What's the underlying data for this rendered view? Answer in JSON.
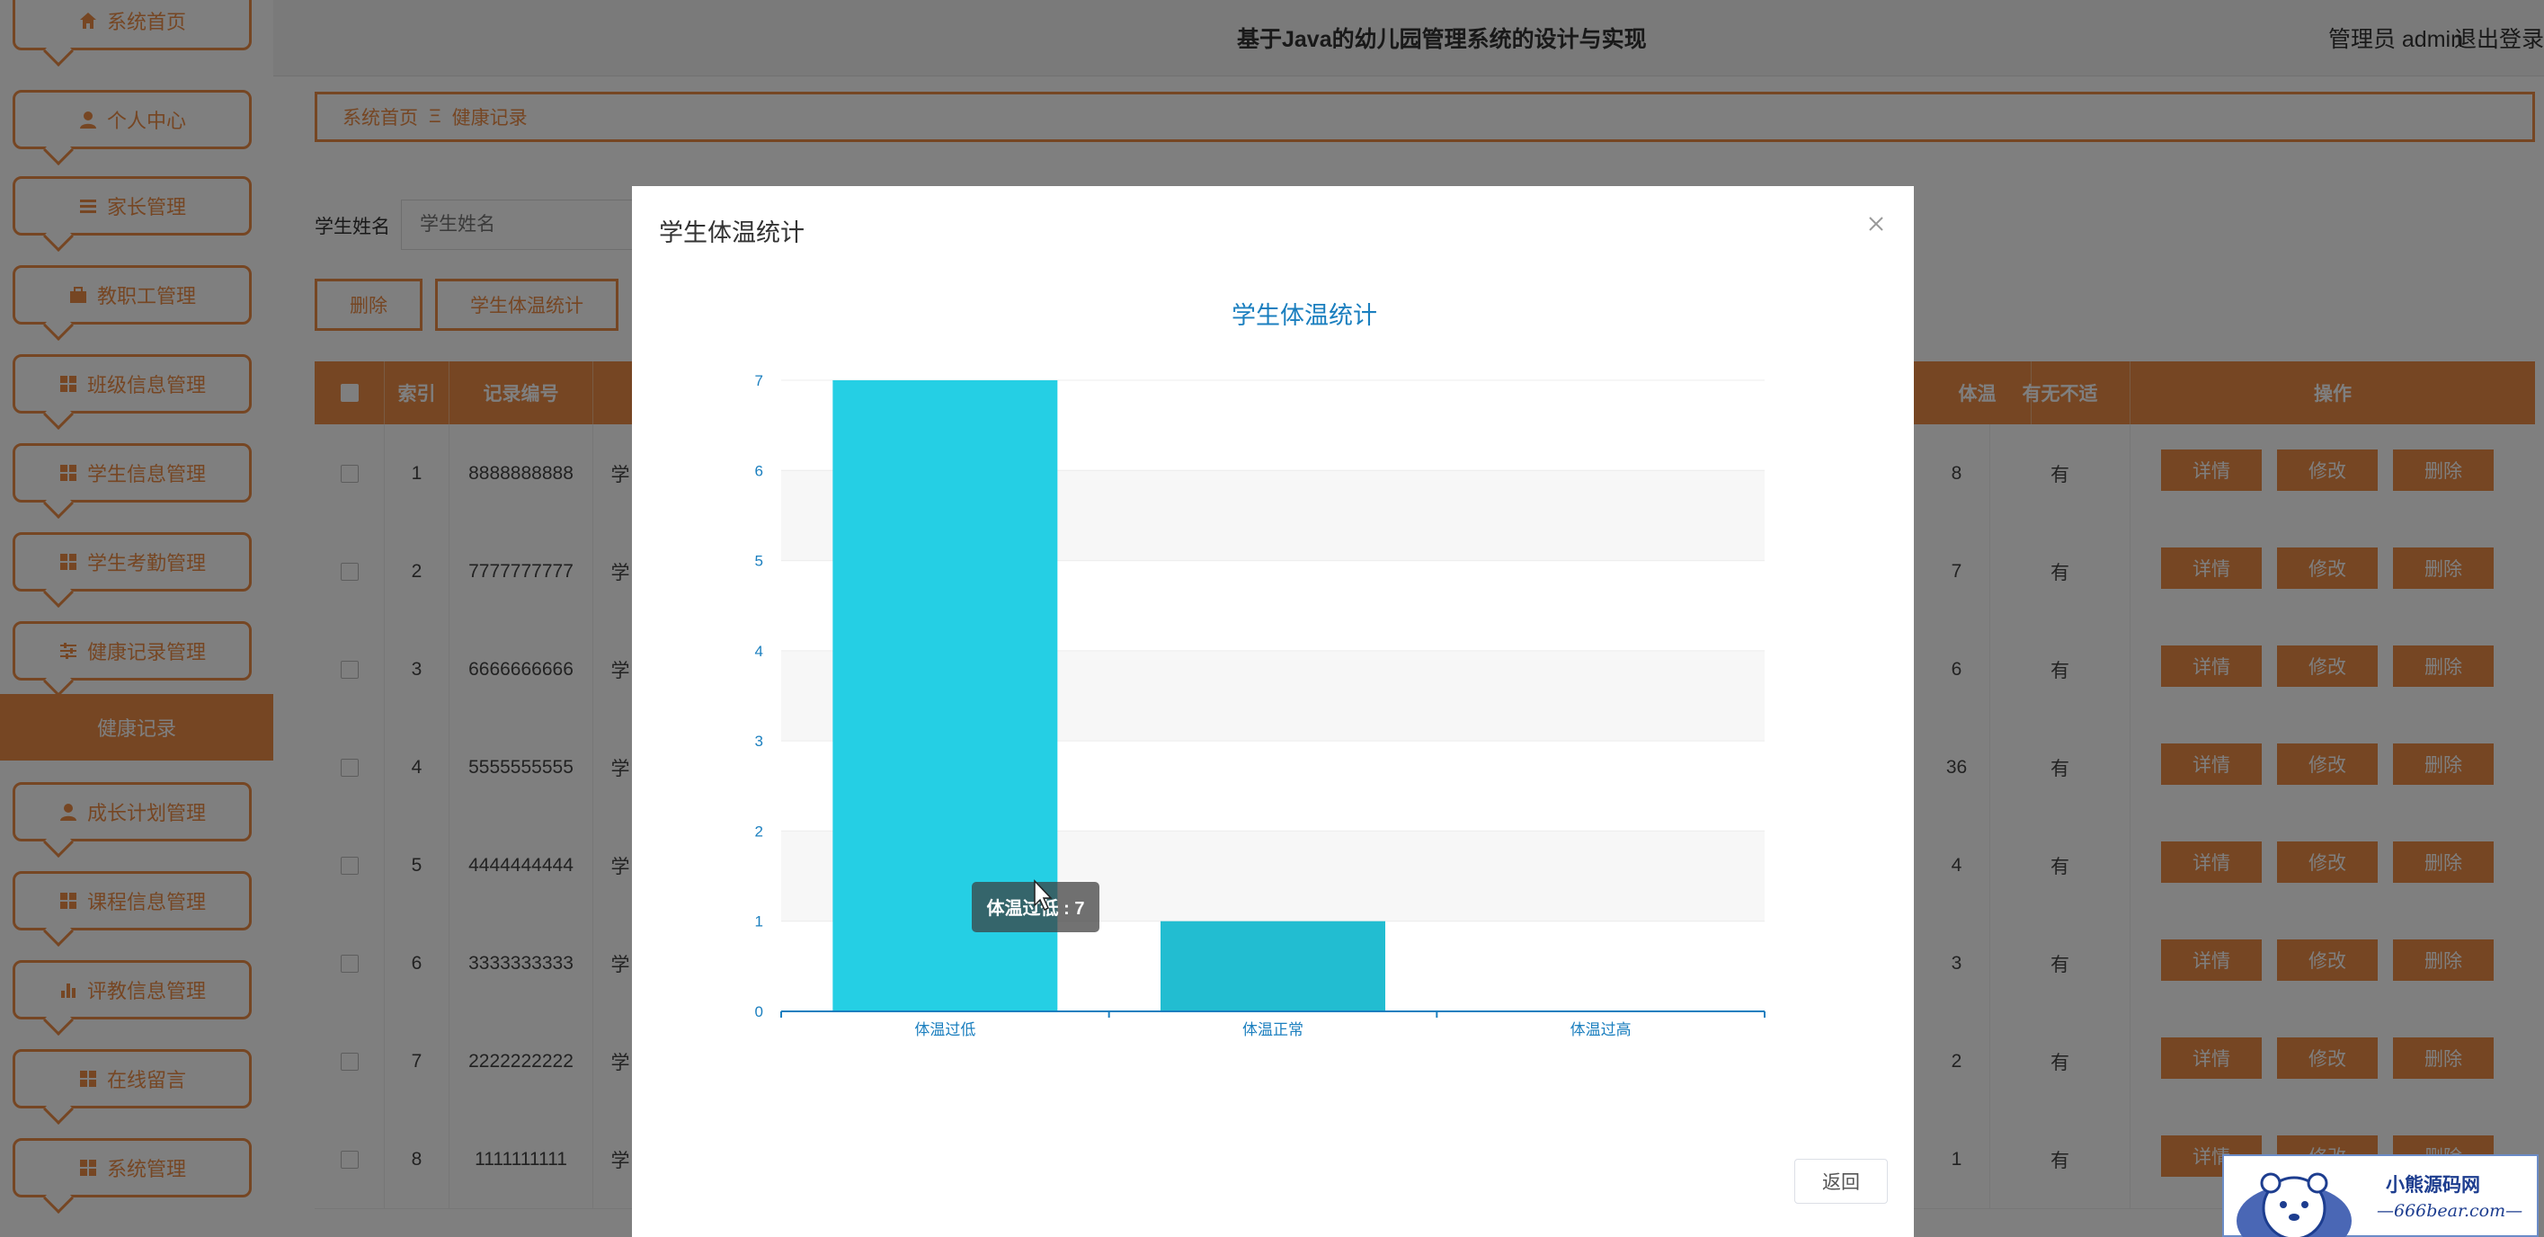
{
  "header": {
    "title": "基于Java的幼儿园管理系统的设计与实现",
    "user": "管理员 admin",
    "logout": "退出登录"
  },
  "sidebar": {
    "items": [
      {
        "label": "系统首页",
        "icon": "home-icon"
      },
      {
        "label": "个人中心",
        "icon": "person-icon"
      },
      {
        "label": "家长管理",
        "icon": "list-icon"
      },
      {
        "label": "教职工管理",
        "icon": "briefcase-icon"
      },
      {
        "label": "班级信息管理",
        "icon": "grid-icon"
      },
      {
        "label": "学生信息管理",
        "icon": "grid-icon"
      },
      {
        "label": "学生考勤管理",
        "icon": "grid-icon"
      },
      {
        "label": "健康记录管理",
        "icon": "sliders-icon"
      },
      {
        "label": "成长计划管理",
        "icon": "person-icon"
      },
      {
        "label": "课程信息管理",
        "icon": "grid-icon"
      },
      {
        "label": "评教信息管理",
        "icon": "bar-chart-icon"
      },
      {
        "label": "在线留言",
        "icon": "grid-icon"
      },
      {
        "label": "系统管理",
        "icon": "grid-icon"
      }
    ],
    "active_sub": "健康记录"
  },
  "breadcrumb": {
    "home": "系统首页",
    "separator": "Ξ",
    "current": "健康记录"
  },
  "search": {
    "label": "学生姓名",
    "placeholder": "学生姓名"
  },
  "toolbar": {
    "delete_label": "删除",
    "stats_label": "学生体温统计"
  },
  "table": {
    "headers": [
      "索引",
      "记录编号",
      "体温",
      "有无不适",
      "操作"
    ],
    "rows": [
      {
        "index": "1",
        "code": "8888888888",
        "s": "学",
        "temp": "8",
        "discomfort": "有"
      },
      {
        "index": "2",
        "code": "7777777777",
        "s": "学",
        "temp": "7",
        "discomfort": "有"
      },
      {
        "index": "3",
        "code": "6666666666",
        "s": "学",
        "temp": "6",
        "discomfort": "有"
      },
      {
        "index": "4",
        "code": "5555555555",
        "s": "学",
        "temp": "36",
        "discomfort": "有"
      },
      {
        "index": "5",
        "code": "4444444444",
        "s": "学",
        "temp": "4",
        "discomfort": "有"
      },
      {
        "index": "6",
        "code": "3333333333",
        "s": "学",
        "temp": "3",
        "discomfort": "有"
      },
      {
        "index": "7",
        "code": "2222222222",
        "s": "学",
        "temp": "2",
        "discomfort": "有"
      },
      {
        "index": "8",
        "code": "1111111111",
        "s": "学",
        "temp": "1",
        "discomfort": "有"
      }
    ],
    "actions": [
      "详情",
      "修改",
      "删除"
    ]
  },
  "modal": {
    "title": "学生体温统计",
    "return_label": "返回",
    "tooltip": {
      "label": "体温过低",
      "value": "7"
    }
  },
  "chart_data": {
    "type": "bar",
    "title": "学生体温统计",
    "categories": [
      "体温过低",
      "体温正常",
      "体温过高"
    ],
    "values": [
      7,
      1,
      0
    ],
    "ylim": [
      0,
      7
    ],
    "yticks": [
      0,
      1,
      2,
      3,
      4,
      5,
      6,
      7
    ],
    "grid": true,
    "colors": [
      "#25cfe4",
      "#22bdd1",
      "#22bdd1"
    ]
  },
  "watermark": {
    "title": "小熊源码网",
    "url": "—666bear.com—"
  },
  "colors": {
    "accent": "#ec8d47",
    "chart_text": "#1b7fbf",
    "bar": "#25cfe4"
  }
}
